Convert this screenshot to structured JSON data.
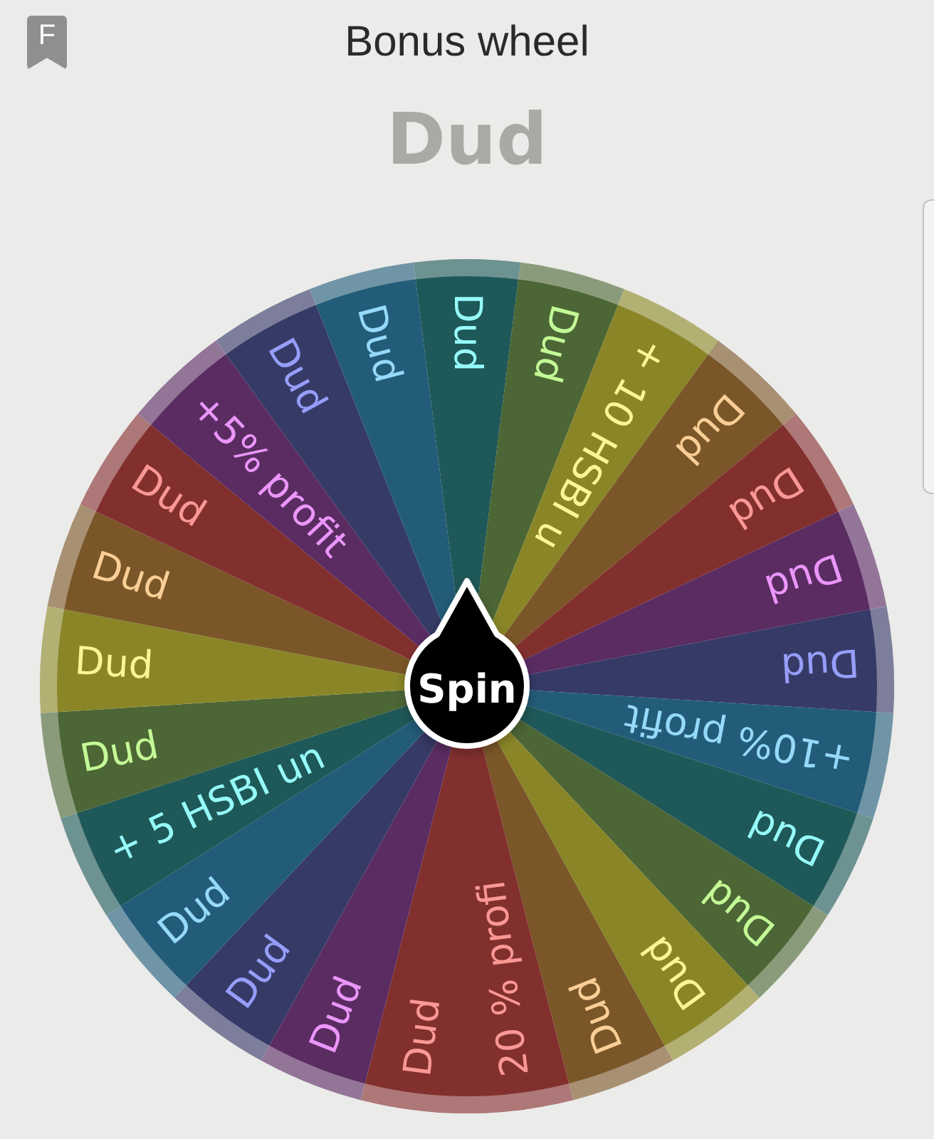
{
  "header": {
    "badge_letter": "F",
    "title": "Bonus wheel"
  },
  "result": "Dud",
  "wheel": {
    "spin_label": "Spin",
    "segments": [
      {
        "label": "Dud",
        "color": "#1f5858"
      },
      {
        "label": "Dud",
        "color": "#4c6636"
      },
      {
        "label": "+ 10 HSBI u",
        "color": "#8a8628"
      },
      {
        "label": "Dud",
        "color": "#7a5628"
      },
      {
        "label": "Dud",
        "color": "#82302e"
      },
      {
        "label": "Dud",
        "color": "#5a2c62"
      },
      {
        "label": "Dud",
        "color": "#363a66"
      },
      {
        "label": "+10% profit",
        "color": "#235c78"
      },
      {
        "label": "Dud",
        "color": "#1f5858"
      },
      {
        "label": "Dud",
        "color": "#4c6636"
      },
      {
        "label": "Dud",
        "color": "#8a8628"
      },
      {
        "label": "Dud",
        "color": "#7a5628"
      },
      {
        "label": "20 % profi",
        "color": "#82302e"
      },
      {
        "label": "Dud",
        "color": "#82302e"
      },
      {
        "label": "Dud",
        "color": "#5a2c62"
      },
      {
        "label": "Dud",
        "color": "#363a66"
      },
      {
        "label": "Dud",
        "color": "#235c78"
      },
      {
        "label": "+ 5 HSBI un",
        "color": "#1f5858"
      },
      {
        "label": "Dud",
        "color": "#4c6636"
      },
      {
        "label": "Dud",
        "color": "#8a8628"
      },
      {
        "label": "Dud",
        "color": "#7a5628"
      },
      {
        "label": "Dud",
        "color": "#82302e"
      },
      {
        "label": "+5% profit",
        "color": "#5a2c62"
      },
      {
        "label": "Dud",
        "color": "#363a66"
      },
      {
        "label": "Dud",
        "color": "#235c78"
      }
    ]
  }
}
